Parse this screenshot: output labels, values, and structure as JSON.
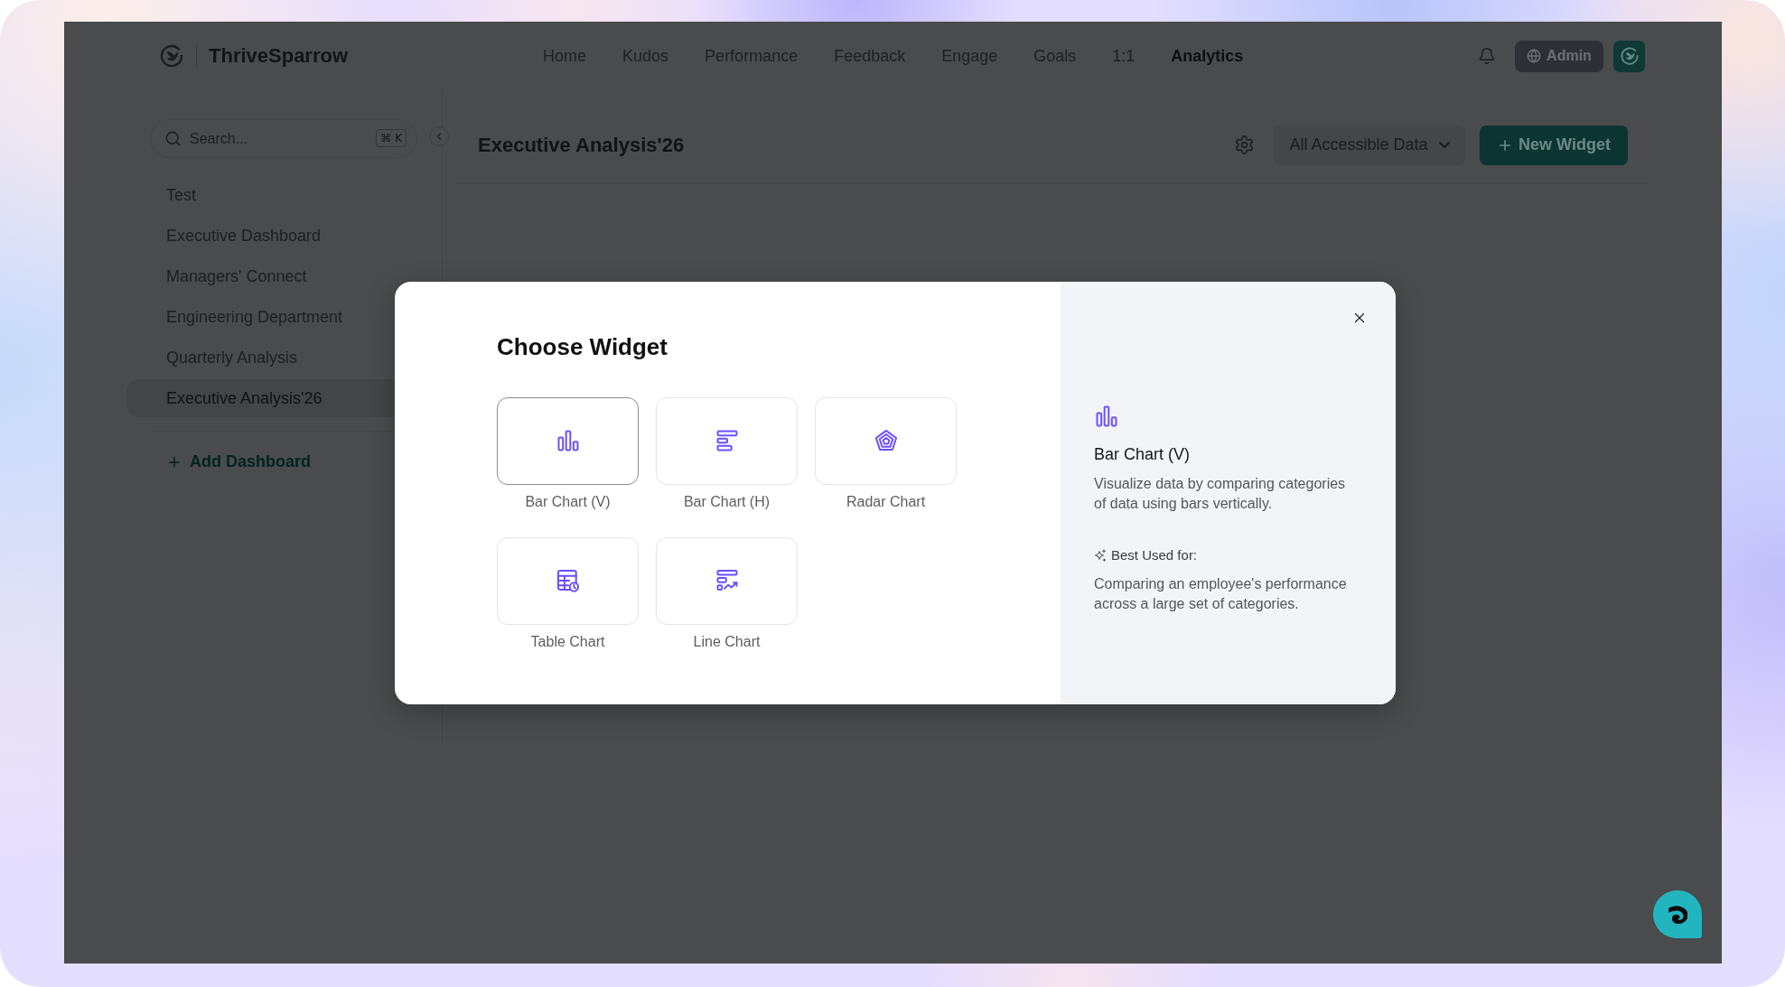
{
  "app": {
    "name": "ThriveSparrow"
  },
  "nav": [
    {
      "label": "Home",
      "selected": false
    },
    {
      "label": "Kudos",
      "selected": false
    },
    {
      "label": "Performance",
      "selected": false
    },
    {
      "label": "Feedback",
      "selected": false
    },
    {
      "label": "Engage",
      "selected": false
    },
    {
      "label": "Goals",
      "selected": false
    },
    {
      "label": "1:1",
      "selected": false
    },
    {
      "label": "Analytics",
      "selected": true
    }
  ],
  "account": {
    "role": "Admin"
  },
  "sidebar": {
    "search": {
      "placeholder": "Search...",
      "shortcut": "⌘ K"
    },
    "items": [
      {
        "label": "Test",
        "selected": false
      },
      {
        "label": "Executive Dashboard",
        "selected": false
      },
      {
        "label": "Managers' Connect",
        "selected": false
      },
      {
        "label": "Engineering Department",
        "selected": false
      },
      {
        "label": "Quarterly Analysis",
        "selected": false
      },
      {
        "label": "Executive Analysis'26",
        "selected": true
      }
    ],
    "add_label": "Add Dashboard"
  },
  "main": {
    "title": "Executive Analysis'26",
    "filter": "All Accessible Data",
    "new_widget_label": "New Widget"
  },
  "dialog": {
    "title": "Choose Widget",
    "widgets": [
      {
        "kind": "bar_vertical",
        "label": "Bar Chart (V)",
        "selected": true
      },
      {
        "kind": "bar_horizontal",
        "label": "Bar Chart (H)",
        "selected": false
      },
      {
        "kind": "radar",
        "label": "Radar Chart",
        "selected": false
      },
      {
        "kind": "table",
        "label": "Table Chart",
        "selected": false
      },
      {
        "kind": "line",
        "label": "Line Chart",
        "selected": false
      }
    ],
    "details": {
      "kind": "bar_vertical",
      "title": "Bar Chart (V)",
      "description": "Visualize data by comparing categories of data using bars vertically.",
      "best_used_label": "Best Used for:",
      "best_used_text": "Comparing an employee's performance across a large set of categories."
    }
  }
}
